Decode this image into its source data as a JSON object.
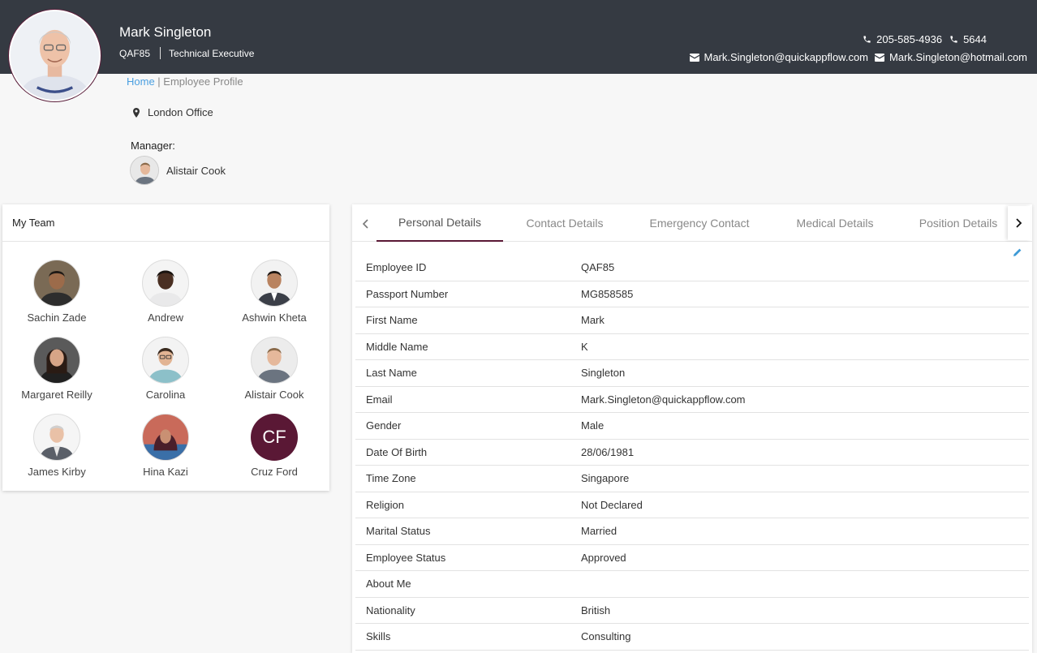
{
  "header": {
    "name": "Mark Singleton",
    "employee_code": "QAF85",
    "job_title": "Technical Executive",
    "phone_primary": "205-585-4936",
    "phone_extension": "5644",
    "email_work": "Mark.Singleton@quickappflow.com",
    "email_personal": "Mark.Singleton@hotmail.com"
  },
  "breadcrumb": {
    "home": "Home",
    "separator": " | ",
    "current": "Employee Profile"
  },
  "location": "London Office",
  "manager": {
    "label": "Manager:",
    "name": "Alistair Cook"
  },
  "team": {
    "title": "My Team",
    "members": [
      {
        "name": "Sachin Zade"
      },
      {
        "name": "Andrew"
      },
      {
        "name": "Ashwin Kheta"
      },
      {
        "name": "Margaret Reilly"
      },
      {
        "name": "Carolina"
      },
      {
        "name": "Alistair Cook"
      },
      {
        "name": "James Kirby"
      },
      {
        "name": "Hina Kazi"
      },
      {
        "name": "Cruz Ford",
        "initials": "CF"
      }
    ]
  },
  "tabs": [
    {
      "label": "Personal Details",
      "active": true
    },
    {
      "label": "Contact Details"
    },
    {
      "label": "Emergency Contact"
    },
    {
      "label": "Medical Details"
    },
    {
      "label": "Position Details"
    }
  ],
  "details": [
    {
      "key": "Employee ID",
      "value": "QAF85"
    },
    {
      "key": "Passport Number",
      "value": "MG858585"
    },
    {
      "key": "First Name",
      "value": "Mark"
    },
    {
      "key": "Middle Name",
      "value": "K"
    },
    {
      "key": "Last Name",
      "value": "Singleton"
    },
    {
      "key": "Email",
      "value": "Mark.Singleton@quickappflow.com"
    },
    {
      "key": "Gender",
      "value": "Male"
    },
    {
      "key": "Date Of Birth",
      "value": "28/06/1981"
    },
    {
      "key": "Time Zone",
      "value": "Singapore"
    },
    {
      "key": "Religion",
      "value": "Not Declared"
    },
    {
      "key": "Marital Status",
      "value": "Married"
    },
    {
      "key": "Employee Status",
      "value": "Approved"
    },
    {
      "key": "About Me",
      "value": ""
    },
    {
      "key": "Nationality",
      "value": "British"
    },
    {
      "key": "Skills",
      "value": "Consulting"
    }
  ],
  "colors": {
    "topbar": "#353a42",
    "accent": "#5a1835",
    "link": "#4a9fe0"
  },
  "icons": {
    "phone": "phone-icon",
    "email": "envelope-icon",
    "location": "map-pin-icon",
    "edit": "pencil-icon",
    "prev": "chevron-left-icon",
    "next": "chevron-right-icon"
  }
}
